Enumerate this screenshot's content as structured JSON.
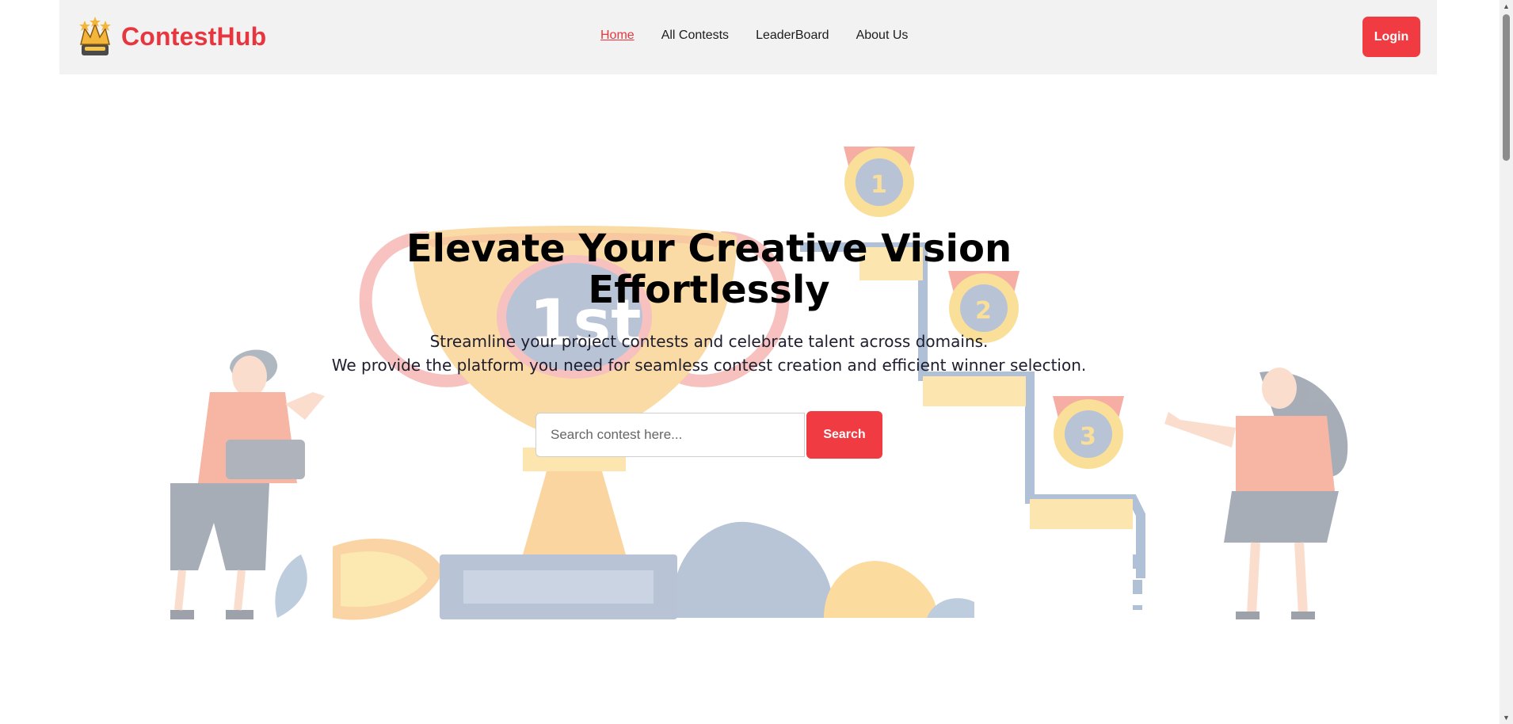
{
  "header": {
    "brand": "ContestHub",
    "nav": [
      {
        "label": "Home",
        "active": true
      },
      {
        "label": "All Contests",
        "active": false
      },
      {
        "label": "LeaderBoard",
        "active": false
      },
      {
        "label": "About Us",
        "active": false
      }
    ],
    "login_label": "Login"
  },
  "hero": {
    "title_lines": [
      "Elevate Your Creative Vision",
      "Effortlessly"
    ],
    "subtitle_lines": [
      "Streamline your project contests and celebrate talent across domains.",
      "We provide the platform you need for seamless contest creation and efficient winner selection."
    ],
    "illustration": {
      "trophy_label": "1st",
      "medal_numbers": [
        "1",
        "2",
        "3"
      ]
    }
  },
  "search": {
    "placeholder": "Search contest here...",
    "button_label": "Search"
  },
  "colors": {
    "accent": "#ef3b41",
    "navbar_bg": "#f2f2f2"
  },
  "icons": [
    "crown-logo-icon"
  ]
}
